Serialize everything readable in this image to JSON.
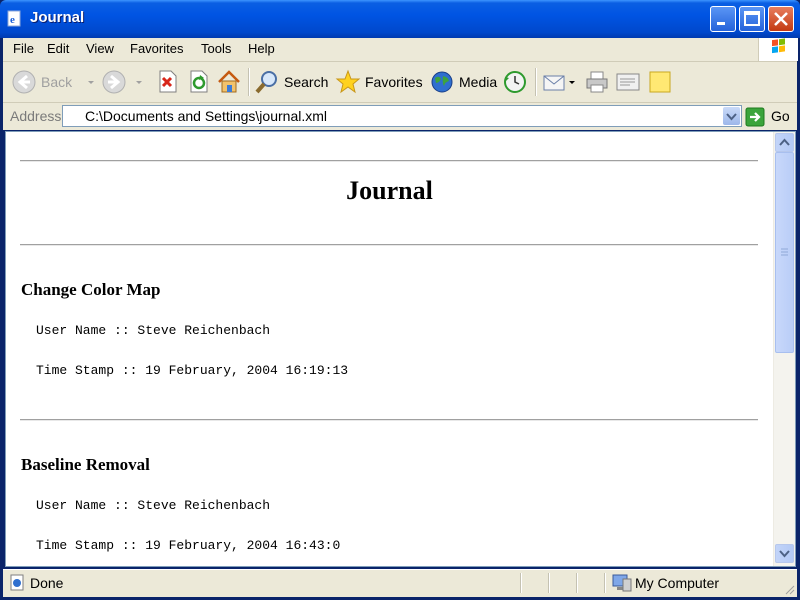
{
  "window": {
    "title": "Journal"
  },
  "menu": {
    "file": "File",
    "edit": "Edit",
    "view": "View",
    "favorites": "Favorites",
    "tools": "Tools",
    "help": "Help"
  },
  "toolbar": {
    "back": "Back",
    "search": "Search",
    "favorites": "Favorites",
    "media": "Media"
  },
  "address": {
    "label": "Address",
    "value": "C:\\Documents and Settings\\journal.xml",
    "go": "Go"
  },
  "page": {
    "title": "Journal",
    "entries": [
      {
        "title": "Change Color Map",
        "user": "User Name :: Steve Reichenbach",
        "time": "Time Stamp :: 19 February, 2004 16:19:13"
      },
      {
        "title": "Baseline Removal",
        "user": "User Name :: Steve Reichenbach",
        "time": "Time Stamp :: 19 February, 2004 16:43:0"
      }
    ]
  },
  "status": {
    "text": "Done",
    "zone": "My Computer"
  },
  "icons": {
    "app": "ie-page-icon",
    "back": "back-arrow-icon",
    "forward": "forward-arrow-icon",
    "stop": "stop-icon",
    "refresh": "refresh-icon",
    "home": "home-icon",
    "search": "search-magnifier-icon",
    "favorites": "star-icon",
    "media": "globe-icon",
    "history": "history-icon",
    "mail": "mail-icon",
    "print": "printer-icon",
    "edit": "edit-icon",
    "discuss": "note-icon",
    "go": "go-arrow-icon",
    "zone": "computer-icon"
  },
  "colors": {
    "titlebar": "#0054E3",
    "close_button": "#C33A12",
    "chrome": "#ECE9D8",
    "content_bg": "#FFFFFF"
  }
}
